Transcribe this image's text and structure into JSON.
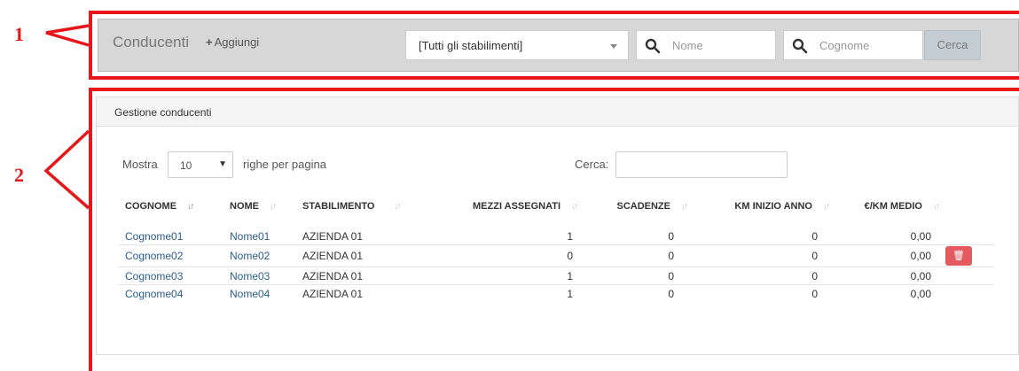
{
  "annotations": {
    "label_1": "1",
    "label_2": "2"
  },
  "toolbar": {
    "title": "Conducenti",
    "add_label": "Aggiungi",
    "plant_select": "[Tutti gli stabilimenti]",
    "name_placeholder": "Nome",
    "surname_placeholder": "Cognome",
    "search_button": "Cerca"
  },
  "panel": {
    "heading": "Gestione conducenti",
    "length_label": "Mostra",
    "length_value": "10",
    "length_suffix": "righe per pagina",
    "filter_label": "Cerca:",
    "filter_value": ""
  },
  "table": {
    "headers": [
      "COGNOME",
      "NOME",
      "STABILIMENTO",
      "MEZZI ASSEGNATI",
      "SCADENZE",
      "KM INIZIO ANNO",
      "€/KM MEDIO"
    ],
    "rows": [
      {
        "cognome": "Cognome01",
        "nome": "Nome01",
        "stabilimento": "AZIENDA 01",
        "mezzi": "1",
        "scadenze": "0",
        "km": "0",
        "media": "0,00"
      },
      {
        "cognome": "Cognome02",
        "nome": "Nome02",
        "stabilimento": "AZIENDA 01",
        "mezzi": "0",
        "scadenze": "0",
        "km": "0",
        "media": "0,00"
      },
      {
        "cognome": "Cognome03",
        "nome": "Nome03",
        "stabilimento": "AZIENDA 01",
        "mezzi": "1",
        "scadenze": "0",
        "km": "0",
        "media": "0,00"
      },
      {
        "cognome": "Cognome04",
        "nome": "Nome04",
        "stabilimento": "AZIENDA 01",
        "mezzi": "1",
        "scadenze": "0",
        "km": "0",
        "media": "0,00"
      }
    ]
  },
  "colors": {
    "annotation": "#e6161a",
    "link": "#2a5d8f",
    "delete": "#e55a5f",
    "toolbar_bg": "#d7d7d7"
  }
}
